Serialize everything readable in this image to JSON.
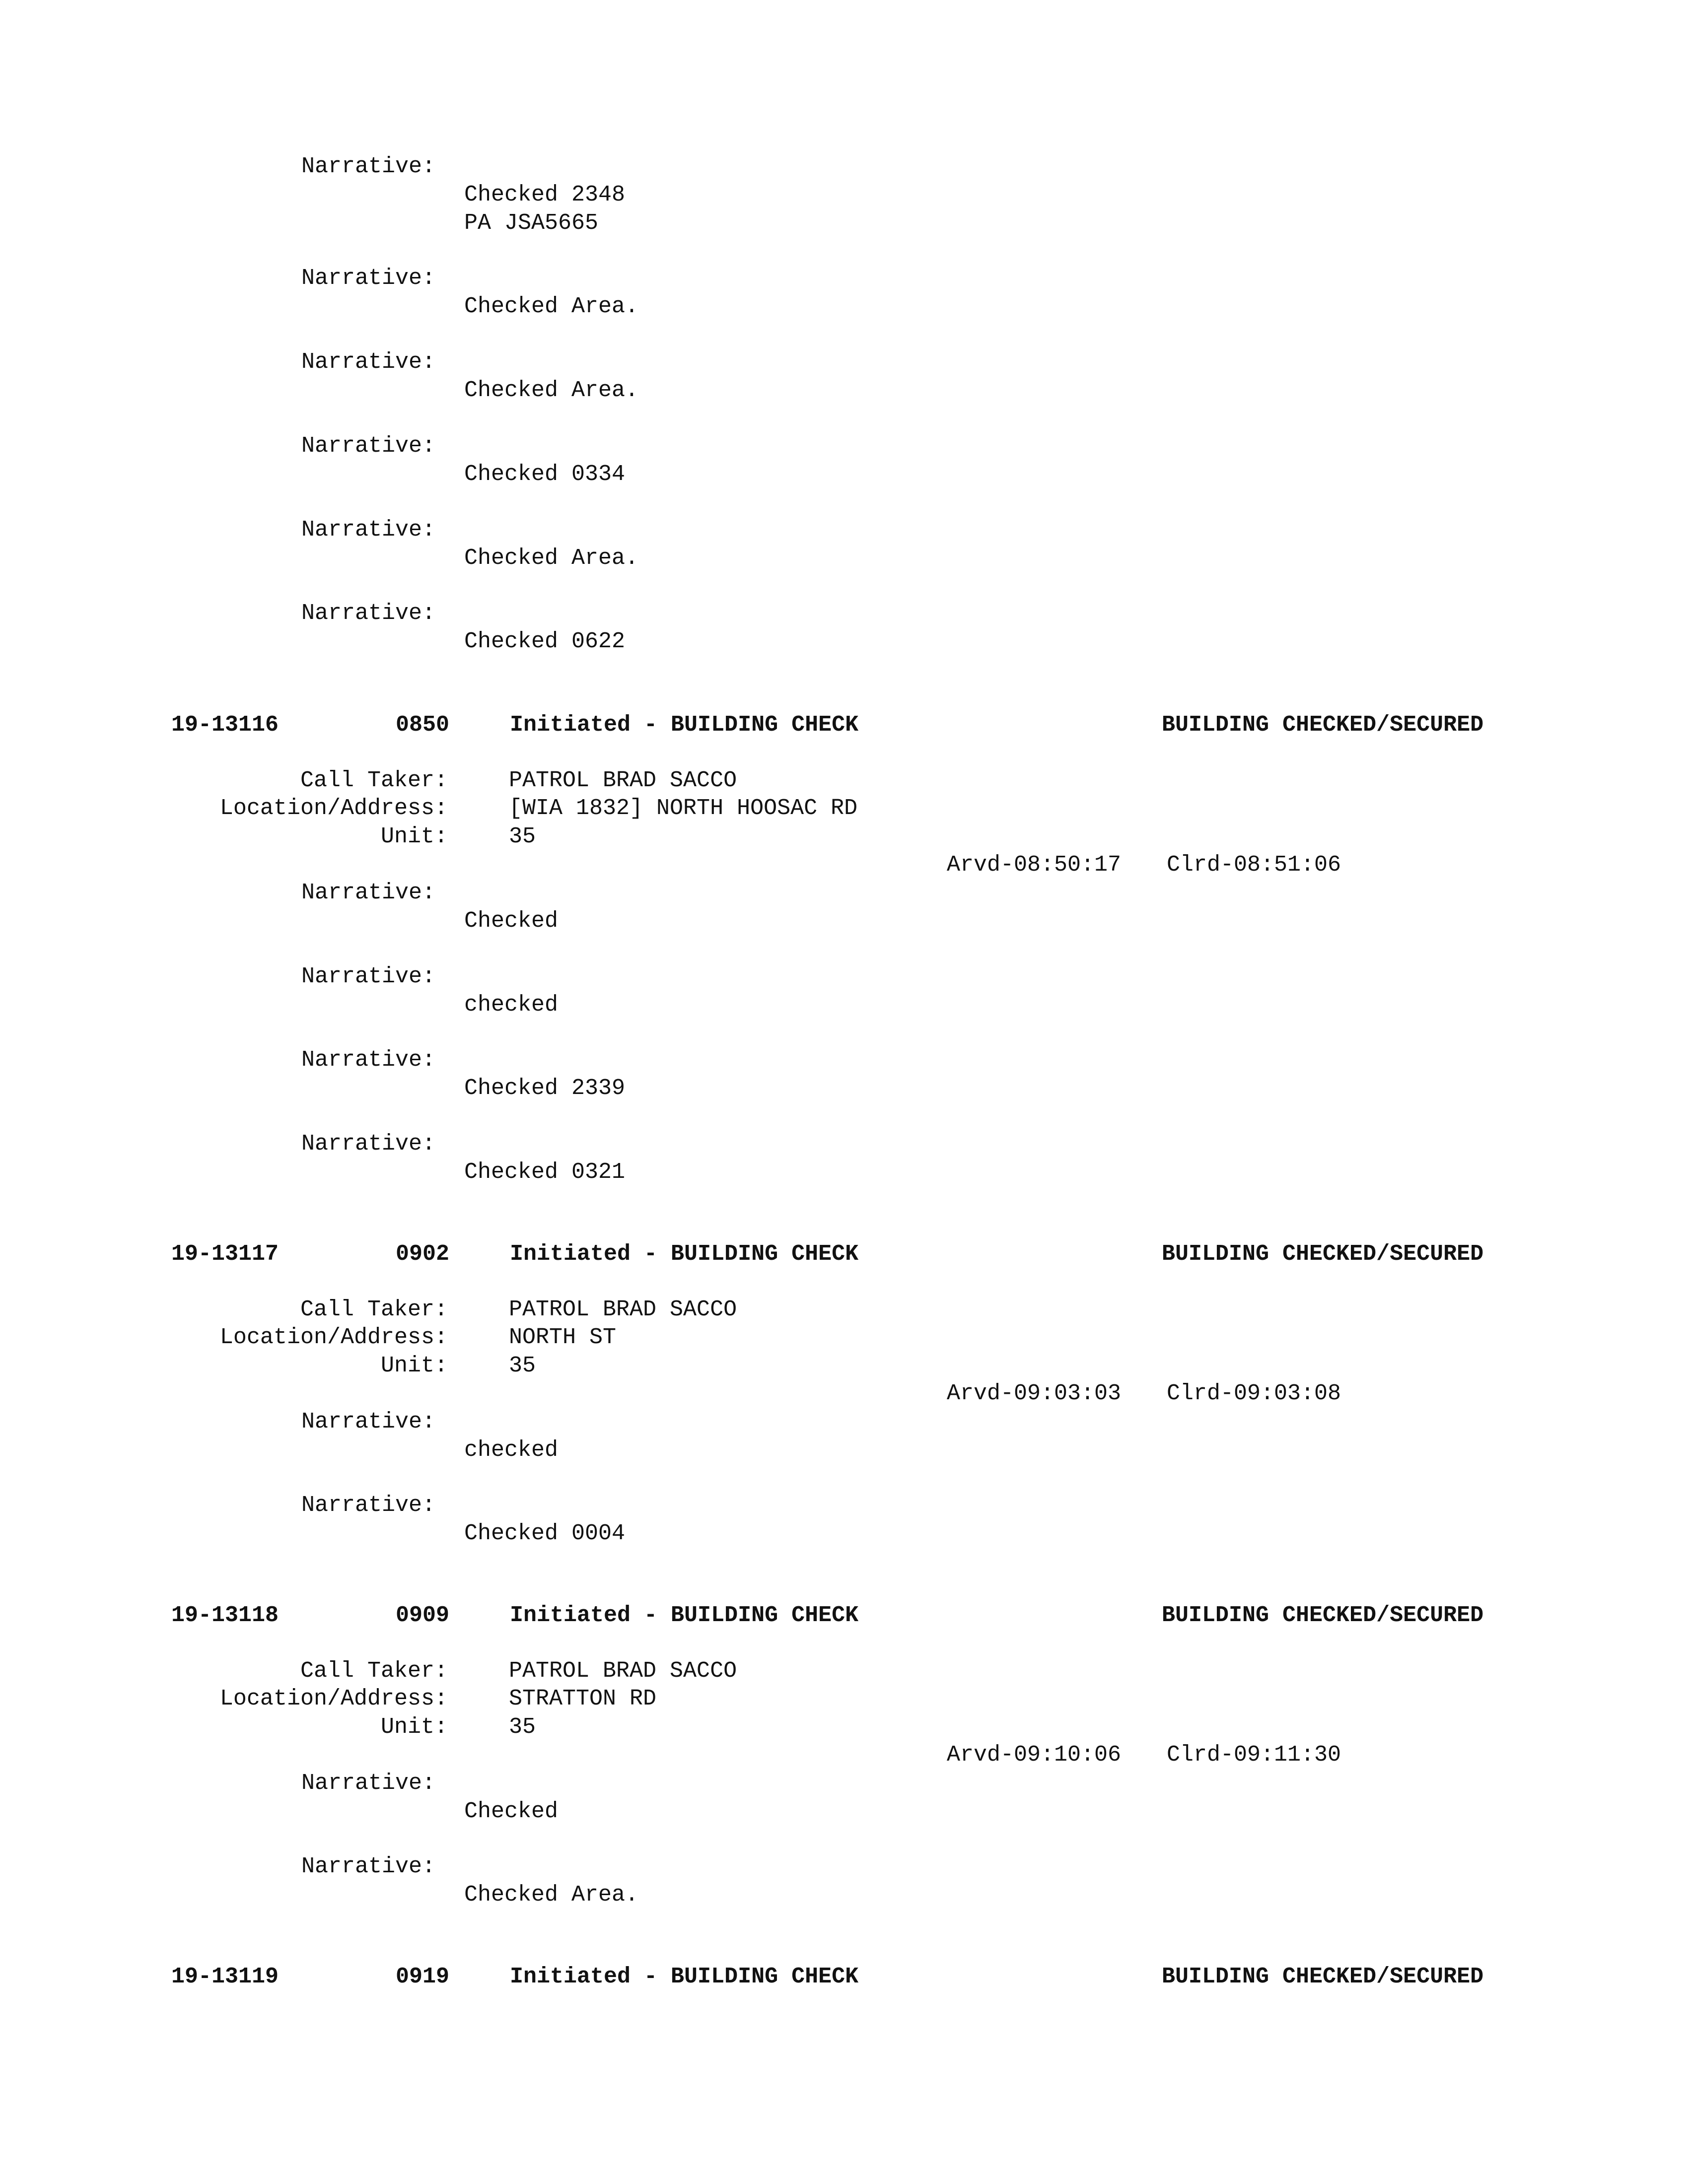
{
  "labels": {
    "narrative": "Narrative:",
    "call_taker": "Call Taker:",
    "location": "Location/Address:",
    "unit": "Unit:"
  },
  "top_narratives": [
    {
      "lines": [
        "Checked 2348",
        "PA JSA5665"
      ]
    },
    {
      "lines": [
        "Checked Area."
      ]
    },
    {
      "lines": [
        "Checked Area."
      ]
    },
    {
      "lines": [
        "Checked 0334"
      ]
    },
    {
      "lines": [
        "Checked Area."
      ]
    },
    {
      "lines": [
        "Checked 0622"
      ]
    }
  ],
  "entries": [
    {
      "id": "19-13116",
      "time": "0850",
      "type": "Initiated - BUILDING CHECK",
      "status": "BUILDING CHECKED/SECURED",
      "call_taker": "PATROL BRAD SACCO",
      "location": "[WIA 1832] NORTH HOOSAC RD",
      "unit": "35",
      "arvd": "Arvd-08:50:17",
      "clrd": "Clrd-08:51:06",
      "narratives": [
        "Checked",
        "checked",
        "Checked 2339",
        "Checked 0321"
      ]
    },
    {
      "id": "19-13117",
      "time": "0902",
      "type": "Initiated - BUILDING CHECK",
      "status": "BUILDING CHECKED/SECURED",
      "call_taker": "PATROL BRAD SACCO",
      "location": "NORTH ST",
      "unit": "35",
      "arvd": "Arvd-09:03:03",
      "clrd": "Clrd-09:03:08",
      "narratives": [
        "checked",
        "Checked 0004"
      ]
    },
    {
      "id": "19-13118",
      "time": "0909",
      "type": "Initiated - BUILDING CHECK",
      "status": "BUILDING CHECKED/SECURED",
      "call_taker": "PATROL BRAD SACCO",
      "location": "STRATTON RD",
      "unit": "35",
      "arvd": "Arvd-09:10:06",
      "clrd": "Clrd-09:11:30",
      "narratives": [
        "Checked",
        "Checked Area."
      ]
    },
    {
      "id": "19-13119",
      "time": "0919",
      "type": "Initiated - BUILDING CHECK",
      "status": "BUILDING CHECKED/SECURED"
    }
  ]
}
